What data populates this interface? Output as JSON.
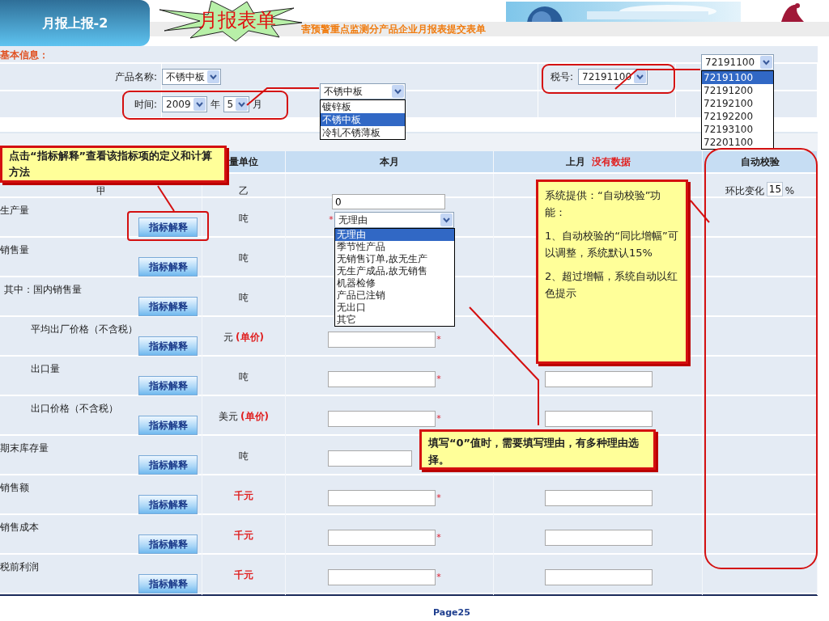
{
  "slide_title": "月报上报-2",
  "starburst_text": "月报表单",
  "header_text": "害预警重点监测分产品企业月报表提交表单",
  "section_label": "基本信息：",
  "product": {
    "label": "产品名称:",
    "value": "不锈中板"
  },
  "date": {
    "label": "时间:",
    "year": "2009",
    "year_unit": "年",
    "month": "5",
    "month_unit": "月"
  },
  "tax": {
    "label": "税号:",
    "value": "72191100"
  },
  "product_popup": {
    "value": "不锈中板",
    "options": [
      {
        "label": "镀锌板",
        "selected": false
      },
      {
        "label": "不锈中板",
        "selected": true
      },
      {
        "label": "冷轧不锈薄板",
        "selected": false
      }
    ]
  },
  "tax_popup": {
    "value": "72191100",
    "options": [
      {
        "label": "72191100",
        "selected": true
      },
      {
        "label": "72191200",
        "selected": false
      },
      {
        "label": "72192100",
        "selected": false
      },
      {
        "label": "72192200",
        "selected": false
      },
      {
        "label": "72193100",
        "selected": false
      },
      {
        "label": "72201100",
        "selected": false
      }
    ]
  },
  "table": {
    "unit_header": "量单位",
    "this_month_header": "本月",
    "last_month_header": "上月",
    "last_month_note": "没有数据",
    "auto_header": "自动校验",
    "code_row": {
      "name_code": "甲",
      "unit_code": "乙"
    },
    "auto_check": {
      "label": "环比变化",
      "value": "15",
      "unit": "%"
    },
    "rows": [
      {
        "label": "生产量",
        "button": "指标解释",
        "unit": "吨",
        "this_month": {
          "kind": "zero_reason",
          "value": "0",
          "mark": "*",
          "reason": "无理由",
          "reason_options": [
            {
              "label": "无理由",
              "selected": true
            },
            {
              "label": "季节性产品",
              "selected": false
            },
            {
              "label": "无销售订单,故无生产",
              "selected": false
            },
            {
              "label": "无生产成品,故无销售",
              "selected": false
            },
            {
              "label": "机器检修",
              "selected": false
            },
            {
              "label": "产品已注销",
              "selected": false
            },
            {
              "label": "无出口",
              "selected": false
            },
            {
              "label": "其它",
              "selected": false
            }
          ]
        },
        "last_month_field": false
      },
      {
        "label": "销售量",
        "button": "指标解释",
        "unit": "吨",
        "last_month_field": false,
        "children": [
          {
            "label": "其中：国内销售量",
            "button": "指标解释",
            "unit": "吨",
            "last_month_field": false,
            "children": [
              {
                "label": "平均出厂价格（不含税）",
                "button": "指标解释",
                "unit": "元",
                "unit_note": "(单价)",
                "this_month": {
                  "kind": "field",
                  "mark": "*"
                },
                "last_month_field": false
              },
              {
                "label": "出口量",
                "button": "指标解释",
                "unit": "吨",
                "this_month": {
                  "kind": "field",
                  "mark": "*"
                },
                "last_month_field": true
              },
              {
                "label": "出口价格（不含税）",
                "button": "指标解释",
                "unit": "美元",
                "unit_note": "(单价)",
                "this_month": {
                  "kind": "field",
                  "mark": "*"
                },
                "last_month_field": true
              }
            ]
          }
        ]
      },
      {
        "label": "期末库存量",
        "button": "指标解释",
        "unit": "吨",
        "this_month": {
          "kind": "partial_field"
        },
        "last_month_field": false
      },
      {
        "label": "销售额",
        "button": "指标解释",
        "unit": "千元",
        "unit_alert": true,
        "this_month": {
          "kind": "field",
          "mark": "*"
        },
        "last_month_field": true
      },
      {
        "label": "销售成本",
        "button": "指标解释",
        "unit": "千元",
        "unit_alert": true,
        "this_month": {
          "kind": "field",
          "mark": "*"
        },
        "last_month_field": true
      },
      {
        "label": "税前利润",
        "button": "指标解释",
        "unit": "千元",
        "unit_alert": true,
        "this_month": {
          "kind": "field",
          "mark": "*"
        },
        "last_month_field": true
      }
    ]
  },
  "callouts": [
    {
      "paragraphs": [
        "点击“指标解释”查看该指标项的定义和计算方法"
      ]
    },
    {
      "paragraphs": [
        "系统提供：“自动校验”功能：",
        "1、自动校验的“同比增幅”可以调整，系统默认15%",
        "2、超过增幅，系统自动以红色提示"
      ]
    },
    {
      "paragraphs": [
        "填写“0”值时，需要填写理由，有多种理由选择。"
      ]
    }
  ],
  "footer": "Page25"
}
